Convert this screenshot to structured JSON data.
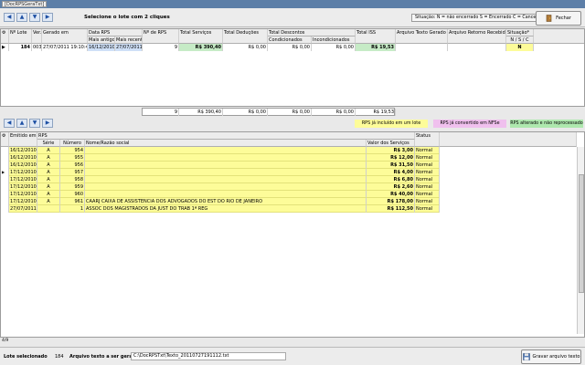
{
  "window": {
    "title": "[DocRPSGeraTxt]"
  },
  "top_toolbar": {
    "nav": [
      "first",
      "prev",
      "next",
      "last"
    ],
    "instruction": "Selecione o lote com 2 cliques",
    "legend": "Situação: N = não encerrado S = Encerrado C = Cancelado",
    "close_label": "Fechar"
  },
  "lots_grid": {
    "headers": {
      "lote": "Nº Lote",
      "ver": "Ver.",
      "gerado": "Gerado em",
      "data_rps": "Data RPS",
      "mais_antigo": "Mais antigo",
      "mais_recente": "Mais recente",
      "num_rps": "Nº de RPS",
      "total_servicos": "Total Serviços",
      "total_deducoes": "Total Deduções",
      "total_descontos": "Total Descontos",
      "condicionados": "Condicionados",
      "incondicionados": "Incondicionados",
      "total_iss": "Total ISS",
      "arq_gerado": "Arquivo Texto Gerado em",
      "arq_retorno": "Arquivo Retorno Recebido em",
      "situacao": "Situação*",
      "situacao_sub": "N / S / C"
    },
    "row": {
      "lote": "184",
      "ver": "003",
      "gerado": "27/07/2011 19:10:46",
      "mais_antigo": "16/12/2010",
      "mais_recente": "27/07/2011",
      "num_rps": "9",
      "total_servicos": "R$ 390,40",
      "total_deducoes": "R$ 0,00",
      "condicionados": "R$ 0,00",
      "incondicionados": "R$ 0,00",
      "total_iss": "R$ 19,53",
      "arq_gerado": "",
      "arq_retorno": "",
      "situacao": "N"
    },
    "totals": {
      "num_rps": "9",
      "total_servicos": "R$ 390,40",
      "total_deducoes": "R$ 0,00",
      "condicionados": "R$ 0,00",
      "incondicionados": "R$ 0,00",
      "total_iss": "R$ 19,53"
    }
  },
  "mid_toolbar": {
    "legend_yellow": "RPS já incluído em um lote",
    "legend_pink": "RPS já convertido em NFSe",
    "legend_green": "RPS alterado e não reprocessado"
  },
  "rps_grid": {
    "headers": {
      "emitido": "Emitido em",
      "rps": "RPS",
      "serie": "Série",
      "numero": "Número",
      "nome": "Nome/Razão social",
      "valor": "Valor dos Serviços",
      "status": "Status"
    },
    "rows": [
      {
        "emitido": "16/12/2010",
        "serie": "A",
        "numero": "954",
        "nome": "",
        "valor": "R$ 3,00",
        "status": "Normal"
      },
      {
        "emitido": "16/12/2010",
        "serie": "A",
        "numero": "955",
        "nome": "",
        "valor": "R$ 12,00",
        "status": "Normal"
      },
      {
        "emitido": "16/12/2010",
        "serie": "A",
        "numero": "956",
        "nome": "",
        "valor": "R$ 31,50",
        "status": "Normal"
      },
      {
        "emitido": "17/12/2010",
        "serie": "A",
        "numero": "957",
        "nome": "",
        "valor": "R$ 4,00",
        "status": "Normal"
      },
      {
        "emitido": "17/12/2010",
        "serie": "A",
        "numero": "958",
        "nome": "",
        "valor": "R$ 6,80",
        "status": "Normal"
      },
      {
        "emitido": "17/12/2010",
        "serie": "A",
        "numero": "959",
        "nome": "",
        "valor": "R$ 2,60",
        "status": "Normal"
      },
      {
        "emitido": "17/12/2010",
        "serie": "A",
        "numero": "960",
        "nome": "",
        "valor": "R$ 40,00",
        "status": "Normal"
      },
      {
        "emitido": "17/12/2010",
        "serie": "A",
        "numero": "961",
        "nome": "CAARJ CAIXA DE ASSISTENCIA DOS ADVOGADOS DO EST DO RIO DE JANEIRO",
        "valor": "R$ 178,00",
        "status": "Normal"
      },
      {
        "emitido": "27/07/2011",
        "serie": "",
        "numero": "1",
        "nome": "ASSOC DOS MAGISTRADOS DA JUST DO TRAB 1ª REG",
        "valor": "R$ 112,50",
        "status": "Normal"
      }
    ],
    "record_counter": "4/9"
  },
  "status_bar": {
    "lote_label": "Lote selecionado",
    "lote_value": "184",
    "arquivo_label": "Arquivo texto a ser gerado",
    "arquivo_value": "C:\\DocRPSTxt\\Texto_20110727191112.txt",
    "gravar_label": "Gravar arquivo texto"
  },
  "colors": {
    "pink": "#f0c0ee",
    "yellow": "#fdfc99",
    "green": "#aee8ae"
  }
}
